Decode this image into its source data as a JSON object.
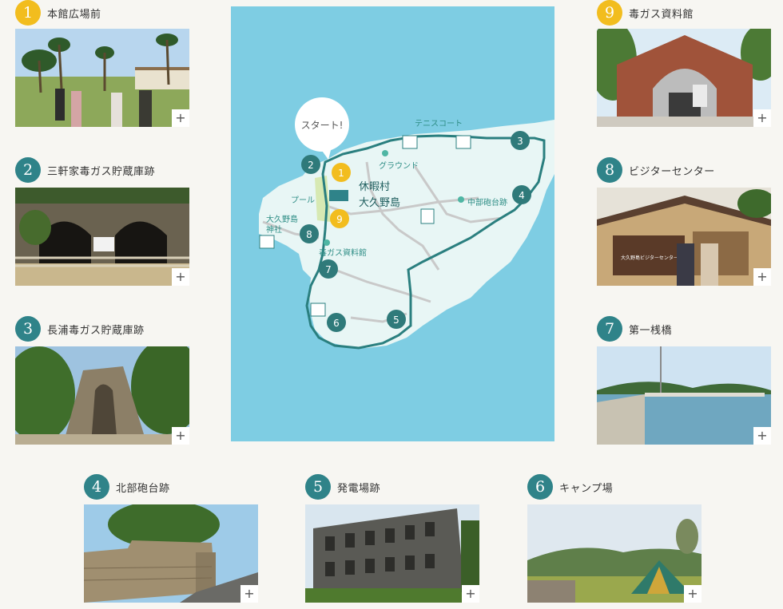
{
  "spots": [
    {
      "num": "1",
      "label": "本館広場前"
    },
    {
      "num": "2",
      "label": "三軒家毒ガス貯蔵庫跡"
    },
    {
      "num": "3",
      "label": "長浦毒ガス貯蔵庫跡"
    },
    {
      "num": "4",
      "label": "北部砲台跡"
    },
    {
      "num": "5",
      "label": "発電場跡"
    },
    {
      "num": "6",
      "label": "キャンプ場"
    },
    {
      "num": "7",
      "label": "第一桟橋"
    },
    {
      "num": "8",
      "label": "ビジターセンター"
    },
    {
      "num": "9",
      "label": "毒ガス資料館"
    }
  ],
  "expand_label": "+",
  "photo_sign_text": "大久野島ビジターセンター",
  "map": {
    "start_label": "スタート!",
    "tennis_court": "テニスコート",
    "ground": "グラウンド",
    "pool": "プール",
    "shrine": "大久野島\n神社",
    "battery": "中部砲台跡",
    "museum": "毒ガス資料館",
    "resort_line1": "休暇村",
    "resort_line2": "大久野島",
    "markers": [
      "1",
      "2",
      "3",
      "4",
      "5",
      "6",
      "7",
      "8",
      "9"
    ]
  },
  "colors": {
    "teal": "#2f8389",
    "yellow": "#f2bd1e",
    "sea": "#7ecde3",
    "land": "#e8f6f5",
    "route": "#2a7f7f"
  }
}
